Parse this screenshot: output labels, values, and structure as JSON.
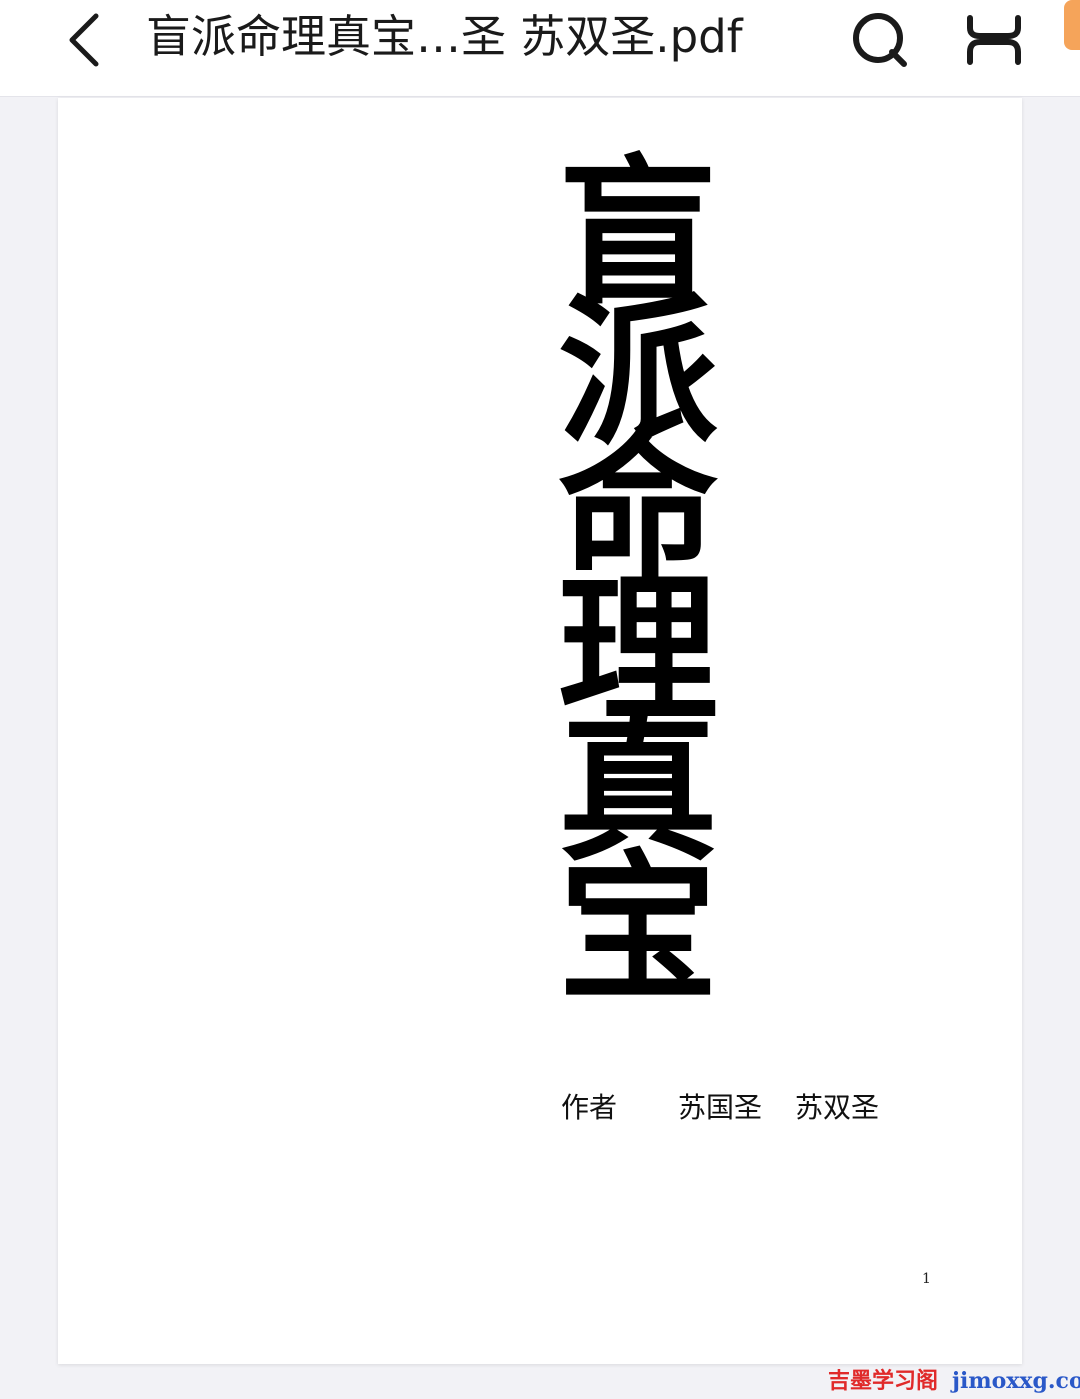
{
  "header": {
    "title": "盲派命理真宝…圣  苏双圣.pdf",
    "back_icon": "chevron-left-icon",
    "search_icon": "search-icon",
    "reader_mode_icon": "reader-mode-icon"
  },
  "page": {
    "title_chars": [
      "盲",
      "派",
      "命",
      "理",
      "真",
      "宝"
    ],
    "author_label": "作者",
    "authors": [
      "苏国圣",
      "苏双圣"
    ],
    "page_number": "1"
  },
  "watermark": {
    "chinese": "吉墨学习阁",
    "domain": "jimoxxg.com"
  },
  "colors": {
    "accent_tab": "#f5a45a",
    "watermark_red": "#e02a2a",
    "watermark_blue": "#2a58c8"
  }
}
